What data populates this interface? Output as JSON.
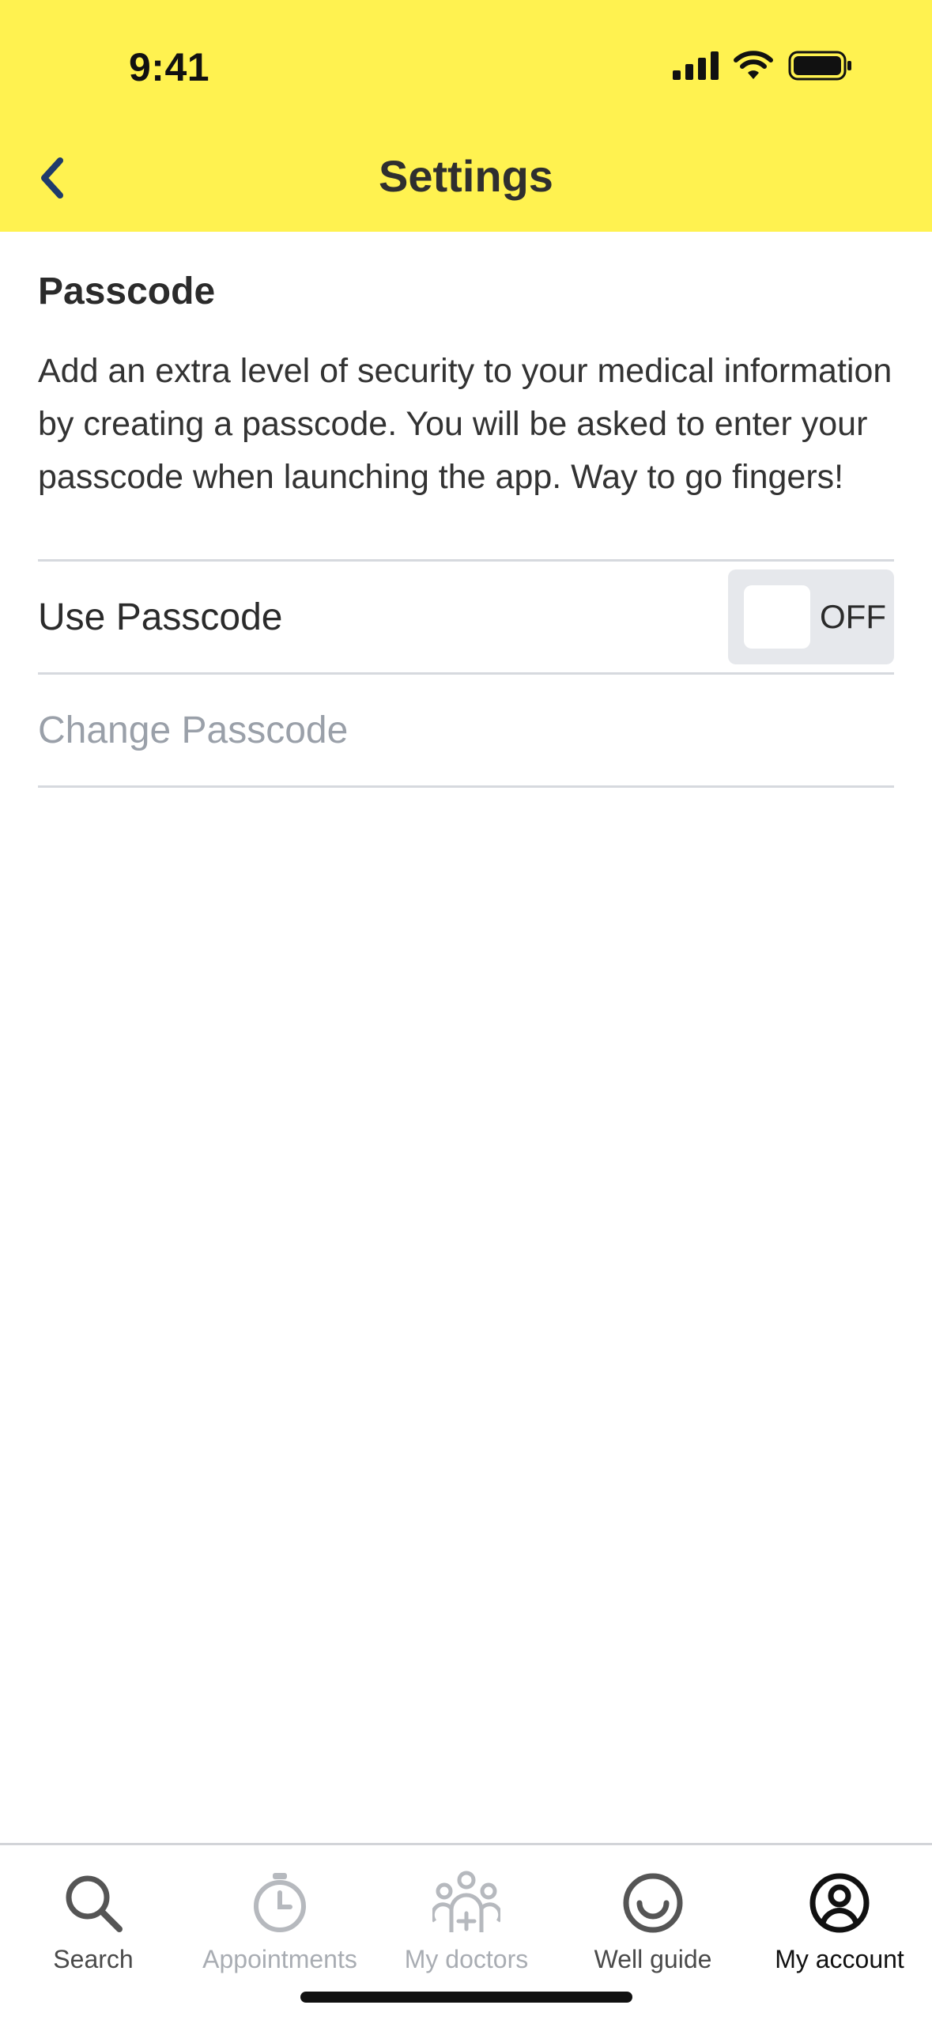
{
  "status_bar": {
    "time": "9:41"
  },
  "nav": {
    "title": "Settings"
  },
  "passcode": {
    "title": "Passcode",
    "description": "Add an extra level of security to your medical information by creating a passcode. You will be asked to enter your passcode when launching the app. Way to go fingers!",
    "use_label": "Use Passcode",
    "toggle_state": "OFF",
    "change_label": "Change Passcode"
  },
  "tabs": [
    {
      "label": "Search",
      "icon": "search-icon"
    },
    {
      "label": "Appointments",
      "icon": "clock-icon"
    },
    {
      "label": "My doctors",
      "icon": "doctors-icon"
    },
    {
      "label": "Well guide",
      "icon": "smile-icon"
    },
    {
      "label": "My account",
      "icon": "account-icon"
    }
  ],
  "colors": {
    "header_bg": "#fff250",
    "back_chevron": "#1f3b6b",
    "disabled_text": "#9aa0a9"
  }
}
